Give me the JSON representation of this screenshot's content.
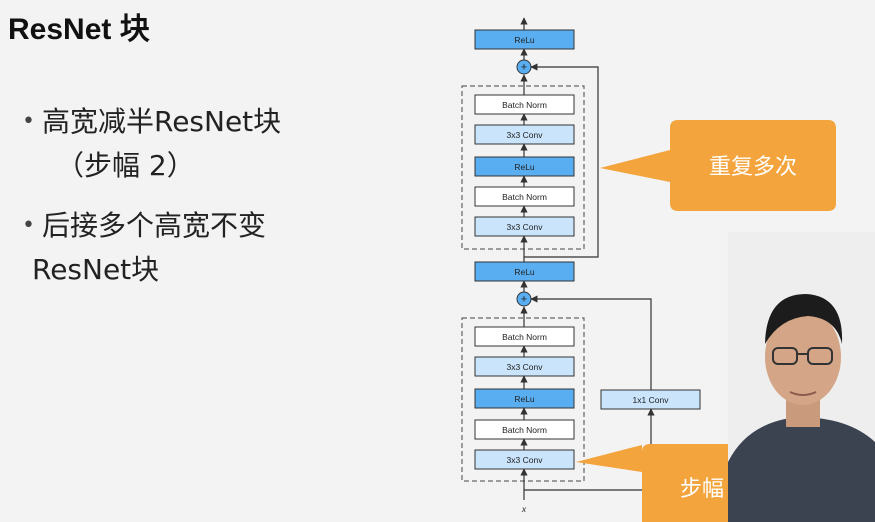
{
  "slide": {
    "title": "ResNet 块",
    "bullets": [
      {
        "lines": [
          "高宽减半ResNet块",
          "（步幅 2）"
        ]
      },
      {
        "lines": [
          "后接多个高宽不变",
          "ResNet块"
        ]
      }
    ]
  },
  "diagram": {
    "top_block": {
      "output_relu": "ReLu",
      "layers": [
        "Batch Norm",
        "3x3 Conv",
        "ReLu",
        "Batch Norm",
        "3x3 Conv"
      ],
      "add_symbol": "+"
    },
    "bottom_block": {
      "output_relu": "ReLu",
      "layers": [
        "Batch Norm",
        "3x3 Conv",
        "ReLu",
        "Batch Norm",
        "3x3 Conv"
      ],
      "shortcut": "1x1 Conv",
      "add_symbol": "+"
    },
    "input_label": "x",
    "callouts": {
      "repeat": "重复多次",
      "stride": "步幅"
    }
  },
  "colors": {
    "highlight_block": "#58aef1",
    "light_block": "#c9e4fb",
    "plain_block": "#ffffff",
    "callout": "#f4a43d"
  }
}
